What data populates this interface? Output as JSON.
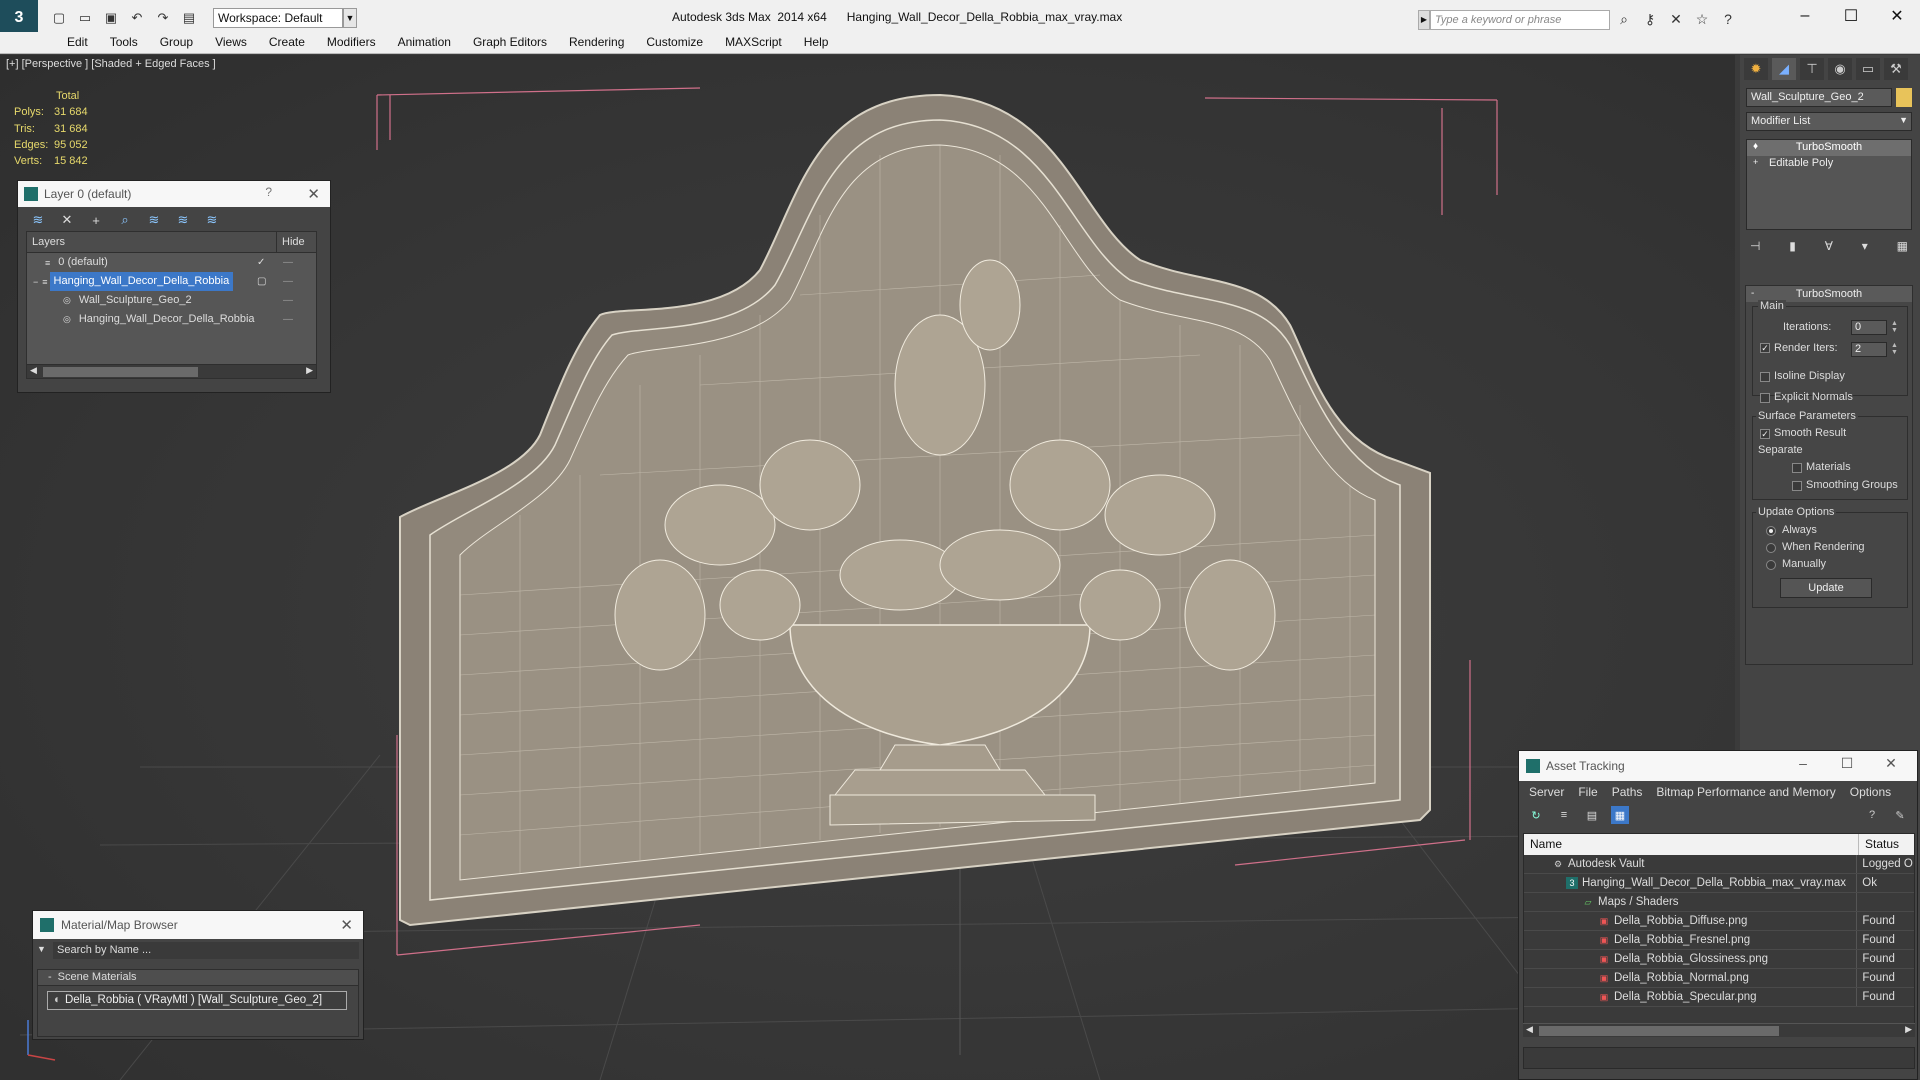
{
  "titlebar": {
    "workspace": "Workspace: Default",
    "title": "Autodesk 3ds Max  2014 x64      Hanging_Wall_Decor_Della_Robbia_max_vray.max",
    "search_placeholder": "Type a keyword or phrase"
  },
  "menu": [
    "Edit",
    "Tools",
    "Group",
    "Views",
    "Create",
    "Modifiers",
    "Animation",
    "Graph Editors",
    "Rendering",
    "Customize",
    "MAXScript",
    "Help"
  ],
  "viewport": {
    "label": "[+] [Perspective ] [Shaded + Edged Faces ]",
    "stats": {
      "header": "Total",
      "rows": [
        {
          "k": "Polys:",
          "v": "31 684"
        },
        {
          "k": "Tris:",
          "v": "31 684"
        },
        {
          "k": "Edges:",
          "v": "95 052"
        },
        {
          "k": "Verts:",
          "v": "15 842"
        }
      ]
    }
  },
  "layer_panel": {
    "title": "Layer 0 (default)",
    "col_layers": "Layers",
    "col_hide": "Hide",
    "rows": [
      {
        "name": "0 (default)"
      },
      {
        "name": "Hanging_Wall_Decor_Della_Robbia"
      },
      {
        "name": "Wall_Sculpture_Geo_2"
      },
      {
        "name": "Hanging_Wall_Decor_Della_Robbia"
      }
    ]
  },
  "command_panel": {
    "object_name": "Wall_Sculpture_Geo_2",
    "modifier_list": "Modifier List",
    "stack": [
      "TurboSmooth",
      "Editable Poly"
    ],
    "rollout_title": "TurboSmooth",
    "main": "Main",
    "iterations_label": "Iterations:",
    "iterations_value": "0",
    "render_iters_label": "Render Iters:",
    "render_iters_value": "2",
    "isoline": "Isoline Display",
    "explicit_normals": "Explicit Normals",
    "surface_params": "Surface Parameters",
    "smooth_result": "Smooth Result",
    "separate": "Separate",
    "materials": "Materials",
    "smoothing_groups": "Smoothing Groups",
    "update_options": "Update Options",
    "always": "Always",
    "when_rendering": "When Rendering",
    "manually": "Manually",
    "update_btn": "Update"
  },
  "asset_tracking": {
    "title": "Asset Tracking",
    "menu": [
      "Server",
      "File",
      "Paths",
      "Bitmap Performance and Memory",
      "Options"
    ],
    "col_name": "Name",
    "col_status": "Status",
    "rows": [
      {
        "name": "Autodesk Vault",
        "status": "Logged O"
      },
      {
        "name": "Hanging_Wall_Decor_Della_Robbia_max_vray.max",
        "status": "Ok"
      },
      {
        "name": "Maps / Shaders",
        "status": ""
      },
      {
        "name": "Della_Robbia_Diffuse.png",
        "status": "Found"
      },
      {
        "name": "Della_Robbia_Fresnel.png",
        "status": "Found"
      },
      {
        "name": "Della_Robbia_Glossiness.png",
        "status": "Found"
      },
      {
        "name": "Della_Robbia_Normal.png",
        "status": "Found"
      },
      {
        "name": "Della_Robbia_Specular.png",
        "status": "Found"
      }
    ]
  },
  "material_browser": {
    "title": "Material/Map Browser",
    "search": "Search by Name ...",
    "section": "Scene Materials",
    "item": "Della_Robbia  ( VRayMtl ) [Wall_Sculpture_Geo_2]"
  }
}
